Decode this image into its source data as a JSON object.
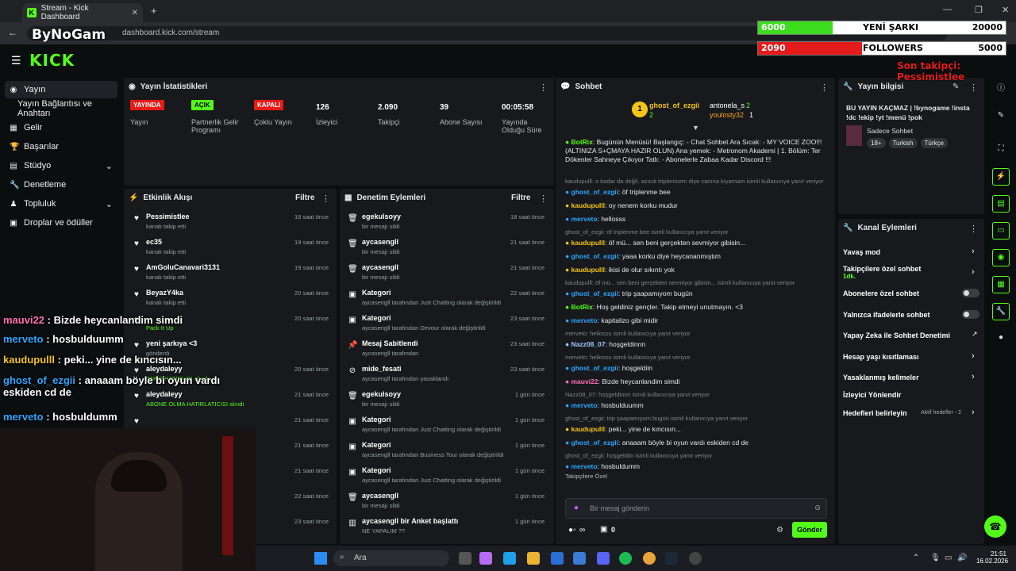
{
  "browser": {
    "tab_title": "Stream - Kick Dashboard",
    "url": "dashboard.kick.com/stream"
  },
  "logo": "KICK",
  "watermark": "ByNoGam",
  "sidebar": {
    "items": [
      {
        "label": "Yayın"
      },
      {
        "label": "Yayın Bağlantısı ve Anahtarı"
      },
      {
        "label": "Gelir"
      },
      {
        "label": "Başarılar"
      },
      {
        "label": "Stüdyo"
      },
      {
        "label": "Denetleme"
      },
      {
        "label": "Topluluk"
      },
      {
        "label": "Droplar ve ödüller"
      }
    ]
  },
  "stats": {
    "title": "Yayın İstatistikleri",
    "items": [
      {
        "badge": "YAYINDA",
        "label": "Yayın",
        "color": "#e91916"
      },
      {
        "badge": "AÇIK",
        "label": "Partnerlik Gelir Programı",
        "color": "#53fc18"
      },
      {
        "badge": "KAPALI",
        "label": "Çoklu Yayın",
        "color": "#e91916"
      },
      {
        "value": "126",
        "label": "İzleyici"
      },
      {
        "value": "2.090",
        "label": "Takipçi"
      },
      {
        "value": "39",
        "label": "Abone Sayısı"
      },
      {
        "value": "00:05:58",
        "label": "Yayında Olduğu Süre"
      }
    ]
  },
  "activity": {
    "title": "Etkinlik Akışı",
    "filter": "Filtre",
    "rows": [
      {
        "name": "Pessimistlee",
        "sub": "kanalı takip etti",
        "time": "16 saat önce"
      },
      {
        "name": "ec35",
        "sub": "kanalı takip etti",
        "time": "19 saat önce"
      },
      {
        "name": "AmGoluCanavari3131",
        "sub": "kanalı takip etti",
        "time": "19 saat önce"
      },
      {
        "name": "BeyazY4ka",
        "sub": "kanalı takip etti",
        "time": "20 saat önce"
      },
      {
        "name": "",
        "sub": "Pack It Up",
        "time": "20 saat önce"
      },
      {
        "name": "yeni şarkıya <3",
        "sub": "gönderdi",
        "time": ""
      },
      {
        "name": "aleydaleyy",
        "sub": "TAKİP HATIRLICI alındı",
        "time": "20 saat önce"
      },
      {
        "name": "aleydaleyy",
        "sub": "ABONE OLMA HATIRLATICISI alındı",
        "time": "21 saat önce"
      },
      {
        "name": "",
        "sub": "",
        "time": "21 saat önce"
      },
      {
        "name": "",
        "sub": "",
        "time": "21 saat önce"
      },
      {
        "name": "",
        "sub": "",
        "time": "21 saat önce"
      },
      {
        "name": "",
        "sub": "",
        "time": "22 saat önce"
      },
      {
        "name": "",
        "sub": "",
        "time": "23 saat önce"
      }
    ]
  },
  "moderation": {
    "title": "Denetim Eylemleri",
    "filter": "Filtre",
    "rows": [
      {
        "icon": "trash-icon",
        "name": "egekulsoyy",
        "sub": "bir mesajı sildi",
        "time": "18 saat önce"
      },
      {
        "icon": "trash-icon",
        "name": "aycasengll",
        "sub": "bir mesajı sildi",
        "time": "21 saat önce"
      },
      {
        "icon": "trash-icon",
        "name": "aycasengll",
        "sub": "bir mesajı sildi",
        "time": "21 saat önce"
      },
      {
        "icon": "category-icon",
        "name": "Kategori",
        "sub": "aycasengll tarafından Just Chatting olarak değiştirildi",
        "time": "22 saat önce"
      },
      {
        "icon": "category-icon",
        "name": "Kategori",
        "sub": "aycasengll tarafından Devour olarak değiştirildi",
        "time": "23 saat önce"
      },
      {
        "icon": "pin-icon",
        "name": "Mesaj Sabitlendi",
        "sub": "aycasengll tarafından",
        "time": "23 saat önce"
      },
      {
        "icon": "ban-icon",
        "name": "mide_fesati",
        "sub": "aycasengll tarafından yasaklandı",
        "time": "23 saat önce"
      },
      {
        "icon": "trash-icon",
        "name": "egekulsoyy",
        "sub": "bir mesajı sildi",
        "time": "1 gün önce"
      },
      {
        "icon": "category-icon",
        "name": "Kategori",
        "sub": "aycasengll tarafından Just Chatting olarak değiştirildi",
        "time": "1 gün önce"
      },
      {
        "icon": "category-icon",
        "name": "Kategori",
        "sub": "aycasengll tarafından Business Tour olarak değiştirildi",
        "time": "1 gün önce"
      },
      {
        "icon": "category-icon",
        "name": "Kategori",
        "sub": "aycasengll tarafından Just Chatting olarak değiştirildi",
        "time": "1 gün önce"
      },
      {
        "icon": "trash-icon",
        "name": "aycasengll",
        "sub": "bir mesajı sildi",
        "time": "1 gün önce"
      },
      {
        "icon": "poll-icon",
        "name": "aycasengll bir Anket başlattı",
        "sub": "NE YAPALIM ??",
        "time": "1 gün önce"
      }
    ]
  },
  "chat": {
    "title": "Sohbet",
    "top": {
      "first": "ghost_of_ezgii",
      "first_count": "2",
      "second": "antonela_s",
      "second_count": "2",
      "third": "youlosty32",
      "third_count": "1"
    },
    "messages": [
      {
        "type": "msg",
        "user": "BotRix",
        "color": "#53fc18",
        "text": "Bugünün Menüsü! Başlangıç: - Chat Sohbet Ara Sıcak: - MY VOICE ZOO!!! (ALTINIZA S+ÇMAYA HAZIR OLUN) Ana yemek: - Metronom Akademi | 1. Bölüm: Ter Dökenler Sahneye Çıkıyor Tatlı: - Abonelerle Zabaa Kadar Discord !!!"
      },
      {
        "type": "reply",
        "text": "kaudupulll: o kadar da değil, azıcık triplenicem diye canına kıyamam isimli kullanıcıya yanıt veriyor"
      },
      {
        "type": "msg",
        "user": "ghost_of_ezgii",
        "color": "#2aa7ff",
        "text": "öf triplenme bee"
      },
      {
        "type": "msg",
        "user": "kaudupulll",
        "color": "#f5c518",
        "text": "oy nenem korku mudur"
      },
      {
        "type": "msg",
        "user": "merveto",
        "color": "#2aa7ff",
        "text": "hellosss"
      },
      {
        "type": "reply",
        "text": "ghost_of_ezgii: öf triplenme bee isimli kullanıcıya yanıt veriyor"
      },
      {
        "type": "msg",
        "user": "kaudupulll",
        "color": "#f5c518",
        "text": "öf mü... sen beni gerçekten sevmiyor gibisin..."
      },
      {
        "type": "msg",
        "user": "ghost_of_ezgii",
        "color": "#2aa7ff",
        "text": "yaaa korku diye heycananmıştım"
      },
      {
        "type": "msg",
        "user": "kaudupulll",
        "color": "#f5c518",
        "text": "ikisi de olur sıkıntı yok"
      },
      {
        "type": "reply",
        "text": "kaudupulll: öf mü... sen beni gerçekten sevmiyor gibisin... isimli kullanıcıya yanıt veriyor"
      },
      {
        "type": "msg",
        "user": "ghost_of_ezgii",
        "color": "#2aa7ff",
        "text": "trip şaapamıyom bugün"
      },
      {
        "type": "msg",
        "user": "BotRix",
        "color": "#53fc18",
        "text": "Hoş geldiniz gençler. Takip etmeyi unutmayın. <3"
      },
      {
        "type": "msg",
        "user": "merveto",
        "color": "#2aa7ff",
        "text": "kapitalizo gibi midir"
      },
      {
        "type": "reply",
        "text": "merveto: hellosss isimli kullanıcıya yanıt veriyor"
      },
      {
        "type": "msg",
        "user": "Nazz08_07",
        "color": "#9ec5ff",
        "text": "hoşgeldinnn"
      },
      {
        "type": "reply",
        "text": "merveto: hellosss isimli kullanıcıya yanıt veriyor"
      },
      {
        "type": "msg",
        "user": "ghost_of_ezgii",
        "color": "#2aa7ff",
        "text": "hoşgeldiin"
      },
      {
        "type": "msg",
        "user": "mauvi22",
        "color": "#ff6fb4",
        "text": "Bizde heycanlandim simdi"
      },
      {
        "type": "reply",
        "text": "Nazz08_07: hoşgeldinnn isimli kullanıcıya yanıt veriyor"
      },
      {
        "type": "msg",
        "user": "merveto",
        "color": "#2aa7ff",
        "text": "hosbulduumm"
      },
      {
        "type": "reply",
        "text": "ghost_of_ezgii: trip şaapamıyom bugün isimli kullanıcıya yanıt veriyor"
      },
      {
        "type": "msg",
        "user": "kaudupulll",
        "color": "#f5c518",
        "text": "peki... yine de kıncısın..."
      },
      {
        "type": "msg",
        "user": "ghost_of_ezgii",
        "color": "#2aa7ff",
        "text": "anaaam böyle bi oyun vardı eskiden cd de"
      },
      {
        "type": "reply",
        "text": "ghost_of_ezgii: hoşgeldiin isimli kullanıcıya yanıt veriyor"
      },
      {
        "type": "msg",
        "user": "merveto",
        "color": "#2aa7ff",
        "text": "hosbuldumm"
      }
    ],
    "followers_only": "Takipçilere Özel",
    "placeholder": "Bir mesaj gönderin",
    "send": "Gönder",
    "points": "∞",
    "gifts": "0"
  },
  "info": {
    "title": "Yayın bilgisi",
    "stream_title": "BU YAYIN KAÇMAZ | !bynogame !insta !dc !ekip !yt !menü !pok",
    "category": "Sadece Sohbet",
    "tags": [
      "18+",
      "Turkish",
      "Türkçe"
    ]
  },
  "actions": {
    "title": "Kanal Eylemleri",
    "items": [
      {
        "label": "Yavaş mod",
        "kind": "chev"
      },
      {
        "label": "Takipçilere özel sohbet",
        "sub": "1dk.",
        "kind": "chev"
      },
      {
        "label": "Abonelere özel sohbet",
        "kind": "toggle"
      },
      {
        "label": "Yalnızca ifadelerle sohbet",
        "kind": "toggle"
      },
      {
        "label": "Yapay Zeka ile Sohbet Denetimi",
        "kind": "ext"
      },
      {
        "label": "Hesap yaşı kısıtlaması",
        "kind": "chev"
      },
      {
        "label": "Yasaklanmış kelimeler",
        "kind": "chev"
      },
      {
        "label": "İzleyici Yönlendir",
        "kind": "none"
      },
      {
        "label": "Hedefleri belirleyin",
        "sub": "Aktif hedefler - 2",
        "kind": "chev"
      }
    ]
  },
  "overlay": {
    "bar1": {
      "left": "6000",
      "mid": "YENİ ŞARKI",
      "right": "20000",
      "progress": 0.3
    },
    "bar2": {
      "left": "2090",
      "mid": "FOLLOWERS",
      "right": "5000",
      "progress": 0.42
    },
    "last_follow": "Son takipçi: Pessimistlee",
    "chat": [
      {
        "user": "mauvi22",
        "color": "#ff6fb4",
        "text": "Bizde heycanlandim simdi"
      },
      {
        "user": "merveto",
        "color": "#2aa7ff",
        "text": "hosbulduumm"
      },
      {
        "user": "kaudupulll",
        "color": "#f5c518",
        "text": "peki... yine de kıncısın..."
      },
      {
        "user": "ghost_of_ezgii",
        "color": "#2aa7ff",
        "text": "anaaam böyle bi oyun vardı eskiden cd de"
      },
      {
        "user": "merveto",
        "color": "#2aa7ff",
        "text": "hosbuldumm"
      }
    ]
  },
  "taskbar": {
    "search": "Ara",
    "time": "21:51",
    "date": "16.02.2026"
  },
  "colors": {
    "accent": "#53fc18",
    "bg": "#0b0e0f",
    "panel": "#17191c"
  }
}
